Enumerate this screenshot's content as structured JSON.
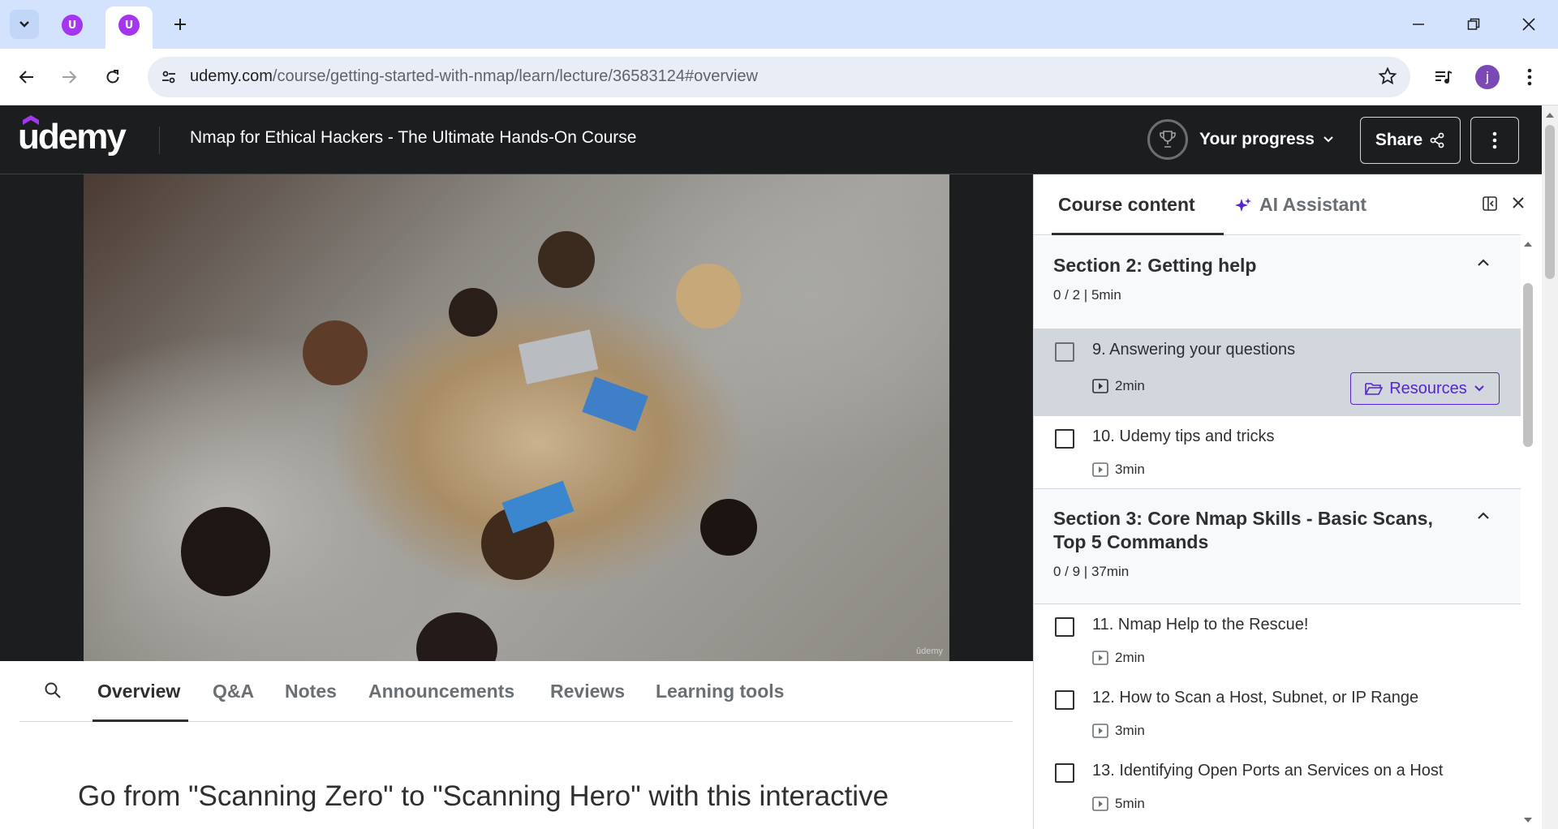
{
  "browser": {
    "url_host": "udemy.com",
    "url_path": "/course/getting-started-with-nmap/learn/lecture/36583124#overview",
    "profile_initial": "j"
  },
  "header": {
    "logo": "udemy",
    "course_title": "Nmap for Ethical Hackers - The Ultimate Hands-On Course",
    "progress_label": "Your progress",
    "share_label": "Share"
  },
  "video": {
    "watermark": "ûdemy"
  },
  "tabs": [
    {
      "label": "Overview"
    },
    {
      "label": "Q&A"
    },
    {
      "label": "Notes"
    },
    {
      "label": "Announcements"
    },
    {
      "label": "Reviews"
    },
    {
      "label": "Learning tools"
    }
  ],
  "overview": {
    "headline": "Go from \"Scanning Zero\" to \"Scanning Hero\" with this interactive"
  },
  "sidebar": {
    "tab_course_content": "Course content",
    "tab_ai_assistant": "AI Assistant",
    "sections": [
      {
        "title": "Section 2: Getting help",
        "meta": "0 / 2 | 5min",
        "lectures": [
          {
            "title": "9. Answering your questions",
            "duration": "2min",
            "current": true,
            "resources_label": "Resources"
          },
          {
            "title": "10. Udemy tips and tricks",
            "duration": "3min"
          }
        ]
      },
      {
        "title": "Section 3: Core Nmap Skills - Basic Scans, Top 5 Commands",
        "meta": "0 / 9 | 37min",
        "lectures": [
          {
            "title": "11. Nmap Help to the Rescue!",
            "duration": "2min"
          },
          {
            "title": "12. How to Scan a Host, Subnet, or IP Range",
            "duration": "3min"
          },
          {
            "title": "13. Identifying Open Ports an Services on a Host",
            "duration": "5min"
          }
        ]
      }
    ]
  },
  "colors": {
    "header_bg": "#1c1d1f",
    "accent_purple": "#5624d0",
    "chrome_tabstrip": "#d3e3fd"
  }
}
